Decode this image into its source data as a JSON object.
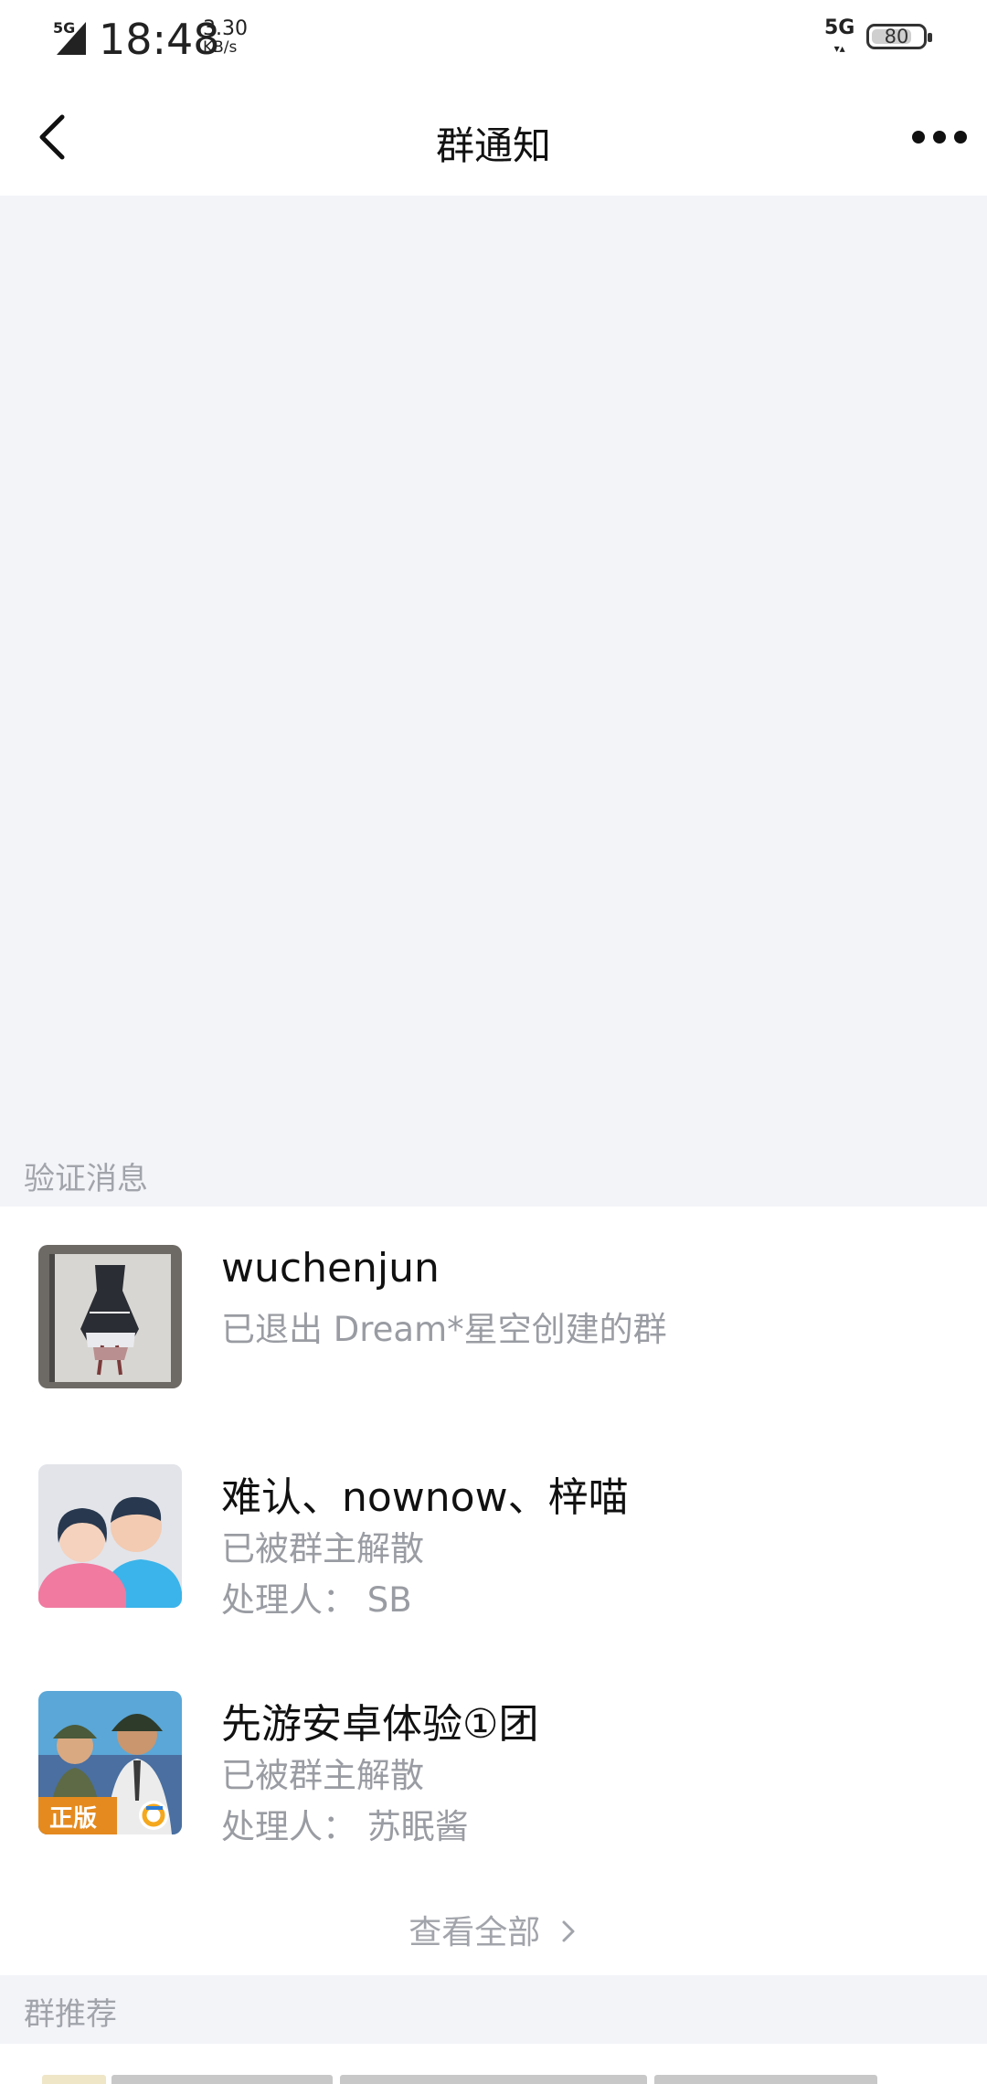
{
  "status_bar": {
    "network_left": "5G",
    "time": "18:48",
    "speed_value": "3.30",
    "speed_unit": "KB/s",
    "network_right": "5G",
    "battery_level": "80",
    "battery_fraction": 0.8
  },
  "nav": {
    "title": "群通知"
  },
  "sections": {
    "verification_label": "验证消息",
    "recommend_label": "群推荐"
  },
  "notices": [
    {
      "title": "wuchenjun",
      "status": "已退出 Dream*星空创建的群",
      "handler": ""
    },
    {
      "title": "难认、nownow、梓喵",
      "status": "已被群主解散",
      "handler": "处理人：  SB"
    },
    {
      "title": "先游安卓体验①团",
      "status": "已被群主解散",
      "handler": "处理人：  苏眠酱"
    }
  ],
  "game_badge": "正版",
  "view_all_label": "查看全部",
  "colors": {
    "page_bg": "#f3f4f8",
    "card_bg": "#ffffff",
    "secondary_text": "#9a9ca3"
  }
}
